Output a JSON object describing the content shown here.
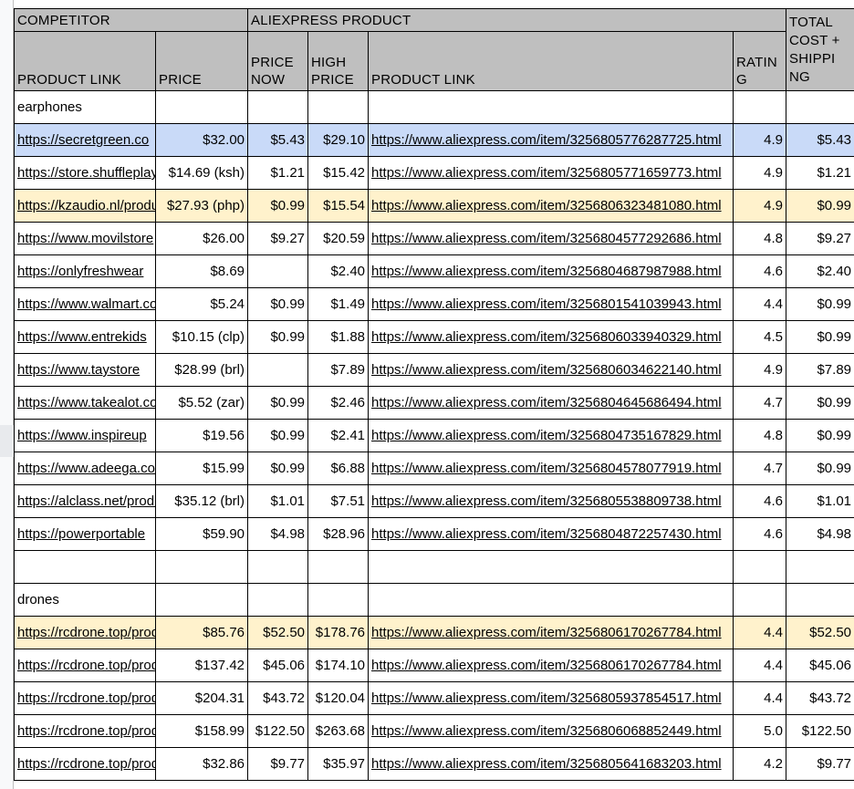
{
  "header": {
    "competitor": "COMPETITOR",
    "aliexpress": "ALIEXPRESS PRODUCT",
    "total": "TOTAL COST + SHIPPING",
    "total_lines": [
      "TOTAL",
      "COST +",
      "SHIPPI",
      "NG"
    ],
    "cols": {
      "comp_link": "PRODUCT LINK",
      "comp_price": "PRICE",
      "price_now_lines": [
        "PRICE",
        "NOW"
      ],
      "high_price_lines": [
        "HIGH",
        "PRICE"
      ],
      "ali_link": "PRODUCT LINK",
      "rating_lines": [
        "RATIN",
        "G"
      ]
    }
  },
  "colors": {
    "header_bg": "#bfbfbf",
    "highlight_blue": "#c9daf8",
    "highlight_yellow": "#fff2cc",
    "link": "#1155cc"
  },
  "sections": {
    "earphones": "earphones",
    "drones": "drones"
  },
  "rows": [
    {
      "comp_link": "https://secretgreen.co",
      "comp_price": "$32.00",
      "price_now": "$5.43",
      "high_price": "$29.10",
      "ali_link": "https://www.aliexpress.com/item/3256805776287725.html",
      "rating": "4.9",
      "total": "$5.43",
      "hl": "blue"
    },
    {
      "comp_link": "https://store.shuffleplay",
      "comp_price": "$14.69 (ksh)",
      "price_now": "$1.21",
      "high_price": "$15.42",
      "ali_link": "https://www.aliexpress.com/item/3256805771659773.html",
      "rating": "4.9",
      "total": "$1.21",
      "hl": ""
    },
    {
      "comp_link": "https://kzaudio.nl/products",
      "comp_price": "$27.93 (php)",
      "price_now": "$0.99",
      "high_price": "$15.54",
      "ali_link": "https://www.aliexpress.com/item/3256806323481080.html",
      "rating": "4.9",
      "total": "$0.99",
      "hl": "yellow"
    },
    {
      "comp_link": "https://www.movilstore",
      "comp_price": "$26.00",
      "price_now": "$9.27",
      "high_price": "$20.59",
      "ali_link": "https://www.aliexpress.com/item/3256804577292686.html",
      "rating": "4.8",
      "total": "$9.27",
      "hl": ""
    },
    {
      "comp_link": "https://onlyfreshwear",
      "comp_price": "$8.69",
      "price_now": "",
      "high_price": "$2.40",
      "ali_link": "https://www.aliexpress.com/item/3256804687987988.html",
      "rating": "4.6",
      "total": "$2.40",
      "hl": ""
    },
    {
      "comp_link": "https://www.walmart.com",
      "comp_price": "$5.24",
      "price_now": "$0.99",
      "high_price": "$1.49",
      "ali_link": "https://www.aliexpress.com/item/3256801541039943.html",
      "rating": "4.4",
      "total": "$0.99",
      "hl": ""
    },
    {
      "comp_link": "https://www.entrekids",
      "comp_price": "$10.15 (clp)",
      "price_now": "$0.99",
      "high_price": "$1.88",
      "ali_link": "https://www.aliexpress.com/item/3256806033940329.html",
      "rating": "4.5",
      "total": "$0.99",
      "hl": ""
    },
    {
      "comp_link": "https://www.taystore",
      "comp_price": "$28.99 (brl)",
      "price_now": "",
      "high_price": "$7.89",
      "ali_link": "https://www.aliexpress.com/item/3256806034622140.html",
      "rating": "4.9",
      "total": "$7.89",
      "hl": ""
    },
    {
      "comp_link": "https://www.takealot.com",
      "comp_price": "$5.52 (zar)",
      "price_now": "$0.99",
      "high_price": "$2.46",
      "ali_link": "https://www.aliexpress.com/item/3256804645686494.html",
      "rating": "4.7",
      "total": "$0.99",
      "hl": ""
    },
    {
      "comp_link": "https://www.inspireup",
      "comp_price": "$19.56",
      "price_now": "$0.99",
      "high_price": "$2.41",
      "ali_link": "https://www.aliexpress.com/item/3256804735167829.html",
      "rating": "4.8",
      "total": "$0.99",
      "hl": ""
    },
    {
      "comp_link": "https://www.adeega.com",
      "comp_price": "$15.99",
      "price_now": "$0.99",
      "high_price": "$6.88",
      "ali_link": "https://www.aliexpress.com/item/3256804578077919.html",
      "rating": "4.7",
      "total": "$0.99",
      "hl": ""
    },
    {
      "comp_link": "https://alclass.net/products",
      "comp_price": "$35.12 (brl)",
      "price_now": "$1.01",
      "high_price": "$7.51",
      "ali_link": "https://www.aliexpress.com/item/3256805538809738.html",
      "rating": "4.6",
      "total": "$1.01",
      "hl": ""
    },
    {
      "comp_link": "https://powerportable",
      "comp_price": "$59.90",
      "price_now": "$4.98",
      "high_price": "$28.96",
      "ali_link": "https://www.aliexpress.com/item/3256804872257430.html",
      "rating": "4.6",
      "total": "$4.98",
      "hl": ""
    }
  ],
  "drone_rows": [
    {
      "comp_link": "https://rcdrone.top/products",
      "comp_price": "$85.76",
      "price_now": "$52.50",
      "high_price": "$178.76",
      "ali_link": "https://www.aliexpress.com/item/3256806170267784.html",
      "rating": "4.4",
      "total": "$52.50",
      "hl": "yellow"
    },
    {
      "comp_link": "https://rcdrone.top/products",
      "comp_price": "$137.42",
      "price_now": "$45.06",
      "high_price": "$174.10",
      "ali_link": "https://www.aliexpress.com/item/3256806170267784.html",
      "rating": "4.4",
      "total": "$45.06",
      "hl": ""
    },
    {
      "comp_link": "https://rcdrone.top/products",
      "comp_price": "$204.31",
      "price_now": "$43.72",
      "high_price": "$120.04",
      "ali_link": "https://www.aliexpress.com/item/3256805937854517.html",
      "rating": "4.4",
      "total": "$43.72",
      "hl": ""
    },
    {
      "comp_link": "https://rcdrone.top/products",
      "comp_price": "$158.99",
      "price_now": "$122.50",
      "high_price": "$263.68",
      "ali_link": "https://www.aliexpress.com/item/3256806068852449.html",
      "rating": "5.0",
      "total": "$122.50",
      "hl": ""
    },
    {
      "comp_link": "https://rcdrone.top/products",
      "comp_price": "$32.86",
      "price_now": "$9.77",
      "high_price": "$35.97",
      "ali_link": "https://www.aliexpress.com/item/3256805641683203.html",
      "rating": "4.2",
      "total": "$9.77",
      "hl": ""
    }
  ]
}
